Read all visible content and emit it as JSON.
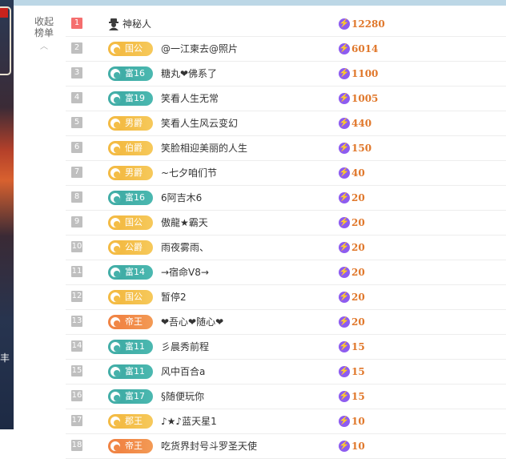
{
  "sidebar": {
    "collapse_label_line1": "收起",
    "collapse_label_line2": "榜单",
    "collapse_chevron": "︿",
    "side_glyph": "丰"
  },
  "colors": {
    "rank_top": "#f56e6e",
    "rank_default": "#bfbfbf",
    "medal_gold": "#f4bd47",
    "medal_teal": "#46b1aa",
    "medal_orange": "#f08746",
    "score_text": "#e0772a",
    "bolt_icon": "#8e5cf0"
  },
  "rows": [
    {
      "rank": "1",
      "medal": null,
      "medal_style": "none",
      "name": "神秘人",
      "score": "12280",
      "top": true
    },
    {
      "rank": "2",
      "medal": "国公",
      "medal_style": "gold",
      "name": "@一江柬去@照片",
      "score": "6014"
    },
    {
      "rank": "3",
      "medal": "富16",
      "medal_style": "teal",
      "name": "糖丸❤佛系了",
      "score": "1100"
    },
    {
      "rank": "4",
      "medal": "富19",
      "medal_style": "teal",
      "name": "笑看人生无常",
      "score": "1005"
    },
    {
      "rank": "5",
      "medal": "男爵",
      "medal_style": "gold",
      "name": "笑看人生风云变幻",
      "score": "440"
    },
    {
      "rank": "6",
      "medal": "伯爵",
      "medal_style": "gold",
      "name": "笑脸相迎美丽的人生",
      "score": "150"
    },
    {
      "rank": "7",
      "medal": "男爵",
      "medal_style": "gold",
      "name": "~七夕咱们节",
      "score": "40"
    },
    {
      "rank": "8",
      "medal": "富16",
      "medal_style": "teal",
      "name": "6阿吉木6",
      "score": "20"
    },
    {
      "rank": "9",
      "medal": "国公",
      "medal_style": "gold",
      "name": "傲龍★霸天",
      "score": "20"
    },
    {
      "rank": "10",
      "medal": "公爵",
      "medal_style": "gold",
      "name": "雨夜雾雨、",
      "score": "20"
    },
    {
      "rank": "11",
      "medal": "富14",
      "medal_style": "teal",
      "name": "→宿命V8→",
      "score": "20"
    },
    {
      "rank": "12",
      "medal": "国公",
      "medal_style": "gold",
      "name": "暂停2",
      "score": "20"
    },
    {
      "rank": "13",
      "medal": "帝王",
      "medal_style": "orange",
      "name": "❤吾心❤随心❤",
      "score": "20"
    },
    {
      "rank": "14",
      "medal": "富11",
      "medal_style": "teal",
      "name": "彡晨秀前程",
      "score": "15"
    },
    {
      "rank": "15",
      "medal": "富11",
      "medal_style": "teal",
      "name": "风中百合a",
      "score": "15"
    },
    {
      "rank": "16",
      "medal": "富17",
      "medal_style": "teal",
      "name": "§随便玩你",
      "score": "15"
    },
    {
      "rank": "17",
      "medal": "郡王",
      "medal_style": "gold",
      "name": "♪★♪蓝天星1",
      "score": "10"
    },
    {
      "rank": "18",
      "medal": "帝王",
      "medal_style": "orange",
      "name": "吃货界封号斗罗圣天使",
      "score": "10"
    }
  ]
}
